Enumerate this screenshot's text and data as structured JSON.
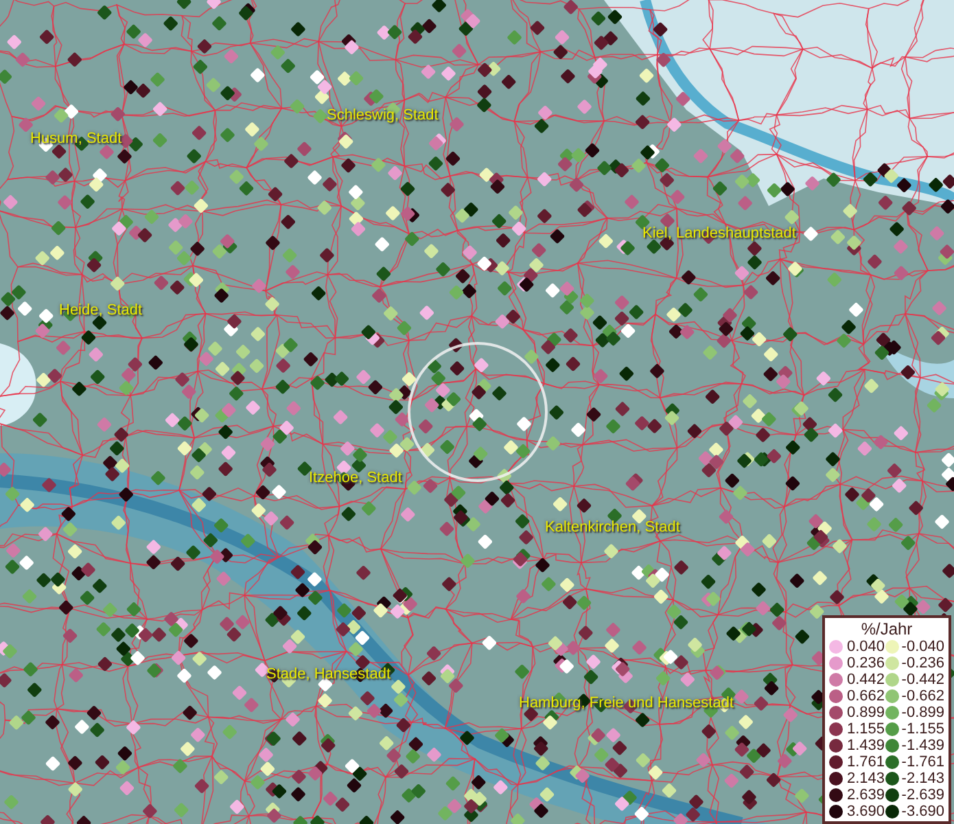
{
  "map": {
    "places": [
      {
        "name": "Husum, Stadt"
      },
      {
        "name": "Schleswig, Stadt"
      },
      {
        "name": "Kiel, Landeshauptstadt"
      },
      {
        "name": "Heide, Stadt"
      },
      {
        "name": "Itzehoe, Stadt"
      },
      {
        "name": "Kaltenkirchen, Stadt"
      },
      {
        "name": "Stade, Hansestadt"
      },
      {
        "name": "Hamburg, Freie und Hansestadt"
      }
    ]
  },
  "legend": {
    "title": "%/Jahr",
    "rows": [
      {
        "positive": {
          "label": "0.040",
          "color": "#f4b8e4"
        },
        "negative": {
          "label": "-0.040",
          "color": "#eef5b8"
        }
      },
      {
        "positive": {
          "label": "0.236",
          "color": "#e59acb"
        },
        "negative": {
          "label": "-0.236",
          "color": "#cfe6a0"
        }
      },
      {
        "positive": {
          "label": "0.442",
          "color": "#cf7aa6"
        },
        "negative": {
          "label": "-0.442",
          "color": "#b0d68a"
        }
      },
      {
        "positive": {
          "label": "0.662",
          "color": "#bb5f86"
        },
        "negative": {
          "label": "-0.662",
          "color": "#90c574"
        }
      },
      {
        "positive": {
          "label": "0.899",
          "color": "#a44a6a"
        },
        "negative": {
          "label": "-0.899",
          "color": "#72b45f"
        }
      },
      {
        "positive": {
          "label": "1.155",
          "color": "#8c3550"
        },
        "negative": {
          "label": "-1.155",
          "color": "#559d48"
        }
      },
      {
        "positive": {
          "label": "1.439",
          "color": "#772a3f"
        },
        "negative": {
          "label": "-1.439",
          "color": "#3e8637"
        }
      },
      {
        "positive": {
          "label": "1.761",
          "color": "#611c2d"
        },
        "negative": {
          "label": "-1.761",
          "color": "#2b6e28"
        }
      },
      {
        "positive": {
          "label": "2.143",
          "color": "#4a1220"
        },
        "negative": {
          "label": "-2.143",
          "color": "#1c561b"
        }
      },
      {
        "positive": {
          "label": "2.639",
          "color": "#330a14"
        },
        "negative": {
          "label": "-2.639",
          "color": "#113e10"
        }
      },
      {
        "positive": {
          "label": "3.690",
          "color": "#20050c"
        },
        "negative": {
          "label": "-3.690",
          "color": "#082806"
        }
      }
    ]
  }
}
